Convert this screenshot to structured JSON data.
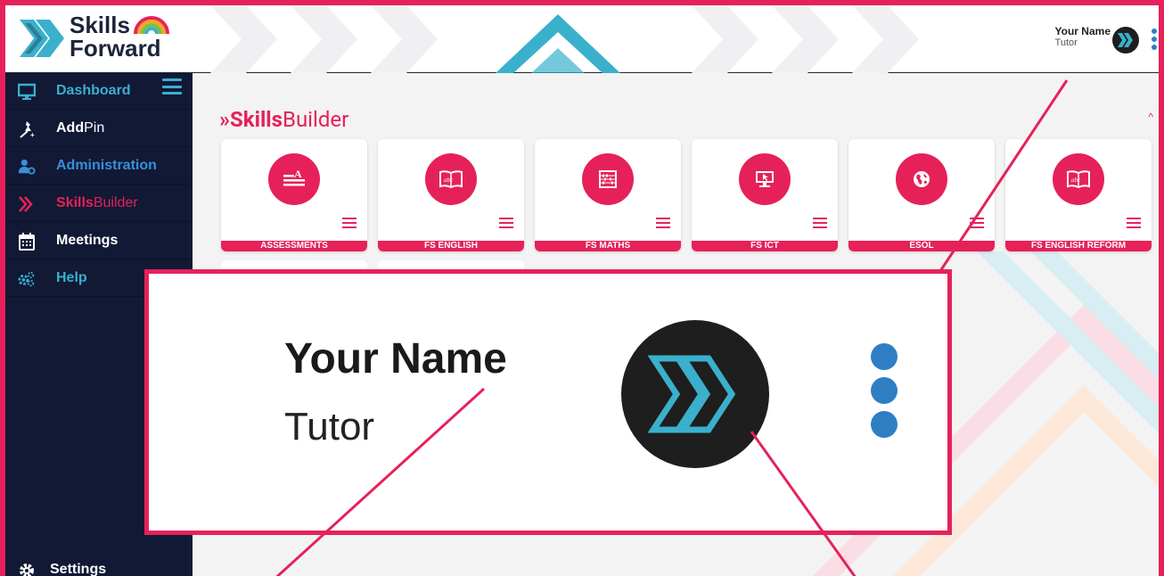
{
  "brand": {
    "line1": "Skills",
    "line2": "Forward"
  },
  "user": {
    "name": "Your Name",
    "role": "Tutor"
  },
  "sidebar": {
    "items": [
      {
        "label_bold": "Dashboard",
        "label_thin": "",
        "color": "#3ab0cc",
        "icon": "monitor-icon"
      },
      {
        "label_bold": "Add",
        "label_thin": "Pin",
        "color": "#ffffff",
        "icon": "pin-icon"
      },
      {
        "label_bold": "Administration",
        "label_thin": "",
        "color": "#3a8fd6",
        "icon": "user-gear-icon"
      },
      {
        "label_bold": "Skills",
        "label_thin": "Builder",
        "color": "#e6215a",
        "icon": "chevrons-icon"
      },
      {
        "label_bold": "Meetings",
        "label_thin": "",
        "color": "#ffffff",
        "icon": "calendar-icon"
      },
      {
        "label_bold": "Help",
        "label_thin": "",
        "color": "#3ab0cc",
        "icon": "cogs-icon"
      }
    ],
    "settings_label": "Settings"
  },
  "section": {
    "title_bold": "Skills",
    "title_thin": "Builder",
    "chevron": "»",
    "caret": "^"
  },
  "cards": [
    {
      "label": "ASSESSMENTS",
      "icon": "text-format-icon"
    },
    {
      "label": "FS ENGLISH",
      "icon": "book-icon"
    },
    {
      "label": "FS MATHS",
      "icon": "abacus-icon"
    },
    {
      "label": "FS ICT",
      "icon": "computer-icon"
    },
    {
      "label": "ESOL",
      "icon": "globe-icon"
    },
    {
      "label": "FS ENGLISH REFORM",
      "icon": "book-icon"
    }
  ],
  "colors": {
    "accent": "#e6215a",
    "navy": "#111935",
    "teal": "#3ab0cc",
    "blue": "#2f7ec4"
  }
}
